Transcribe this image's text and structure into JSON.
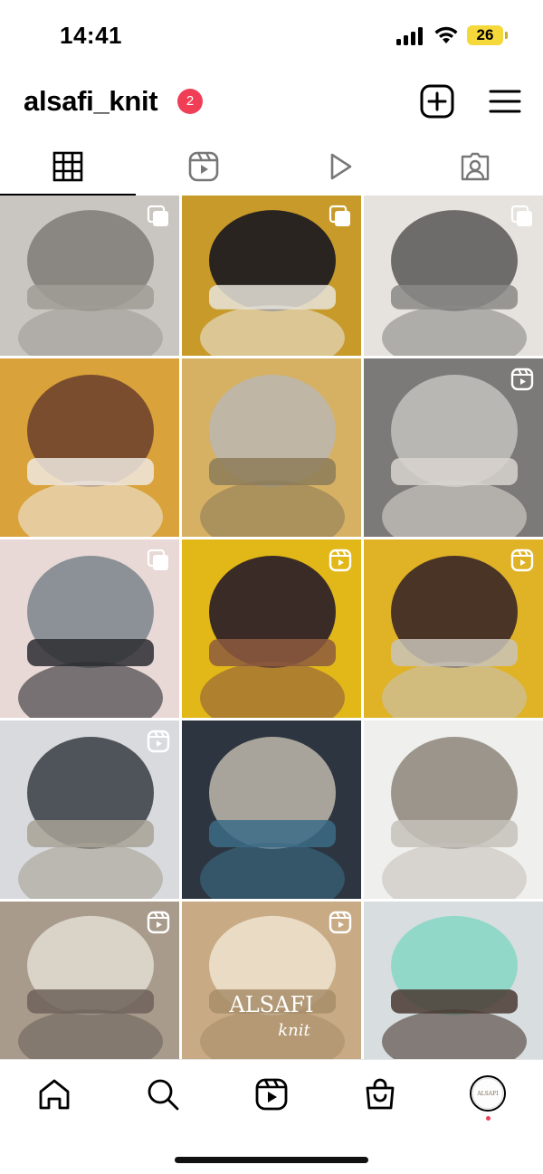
{
  "status_bar": {
    "time": "14:41",
    "battery": "26",
    "battery_color": "#f5d83a"
  },
  "header": {
    "username": "alsafi_knit",
    "notification_count": "2",
    "badge_color": "#ef3e55"
  },
  "tabs": [
    {
      "name": "grid",
      "icon": "grid-icon",
      "active": true
    },
    {
      "name": "reels",
      "icon": "reels-icon",
      "active": false
    },
    {
      "name": "videos",
      "icon": "play-icon",
      "active": false
    },
    {
      "name": "tagged",
      "icon": "tagged-user-icon",
      "active": false
    }
  ],
  "posts": [
    {
      "badge": "carousel",
      "desc": "grey earflap hat"
    },
    {
      "badge": "carousel",
      "desc": "black bonnet"
    },
    {
      "badge": "carousel",
      "desc": "grey hat in hand"
    },
    {
      "badge": "",
      "desc": "brown beanie autumn"
    },
    {
      "badge": "",
      "desc": "grey beanie close"
    },
    {
      "badge": "reel",
      "desc": "grey earflap hat side"
    },
    {
      "badge": "carousel",
      "desc": "grey ushanka"
    },
    {
      "badge": "reel",
      "desc": "brown beanie yellow trees"
    },
    {
      "badge": "reel",
      "desc": "grey beanie back"
    },
    {
      "badge": "reel",
      "desc": "two beanies"
    },
    {
      "badge": "",
      "desc": "selfie in car"
    },
    {
      "badge": "",
      "desc": "beanie on table"
    },
    {
      "badge": "reel",
      "desc": "folded beanies"
    },
    {
      "badge": "reel",
      "desc": "brand bag",
      "brand_text": "ALSAFI",
      "brand_sub": "knit"
    },
    {
      "badge": "",
      "desc": "mint beanie"
    }
  ],
  "bottom_nav": [
    {
      "name": "home",
      "icon": "home-icon"
    },
    {
      "name": "search",
      "icon": "search-icon"
    },
    {
      "name": "reels",
      "icon": "reels-icon"
    },
    {
      "name": "shop",
      "icon": "shop-bag-icon"
    },
    {
      "name": "profile",
      "icon": "profile-avatar",
      "avatar_text": "ALSAFI"
    }
  ]
}
